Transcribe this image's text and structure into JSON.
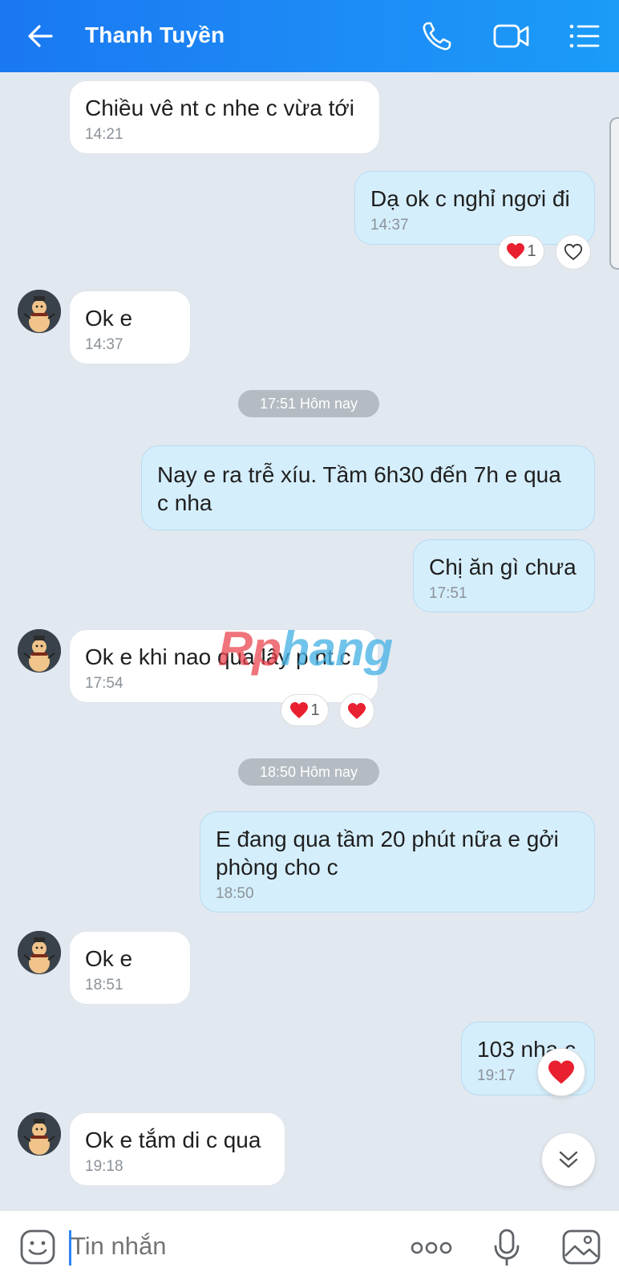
{
  "header": {
    "title": "Thanh Tuyền",
    "icons": [
      "back-arrow-icon",
      "phone-icon",
      "video-camera-icon",
      "menu-list-icon"
    ]
  },
  "messages": [
    {
      "direction": "in",
      "text": "Chiều vê nt c nhe c vừa tới",
      "time": "14:21"
    },
    {
      "direction": "out",
      "text": "Dạ ok c nghỉ ngơi đi",
      "time": "14:37",
      "reaction_count": "1"
    },
    {
      "direction": "in",
      "text": "Ok e",
      "time": "14:37"
    },
    {
      "direction": "out",
      "text": "Nay e ra trễ xíu. Tầm 6h30 đến 7h e qua\nc nha",
      "time": ""
    },
    {
      "direction": "out",
      "text": "Chị ăn gì chưa",
      "time": "17:51"
    },
    {
      "direction": "in",
      "text": "Ok e khi nao qua lây p nt c",
      "time": "17:54",
      "reaction_count": "1"
    },
    {
      "direction": "out",
      "text": "E đang qua tầm 20 phút nữa e gởi\nphòng cho c",
      "time": "18:50"
    },
    {
      "direction": "in",
      "text": "Ok e",
      "time": "18:51"
    },
    {
      "direction": "out",
      "text": "103 nha c",
      "time": "19:17"
    },
    {
      "direction": "in",
      "text": "Ok e tắm di c qua",
      "time": "19:18"
    }
  ],
  "dividers": [
    "17:51 Hôm nay",
    "18:50 Hôm nay"
  ],
  "watermark": {
    "part1": "Rp",
    "part2": "hang"
  },
  "composer": {
    "placeholder": "Tin nhắn"
  },
  "colors": {
    "header": "#1d8df5",
    "outgoing_bubble": "#d5eefc",
    "incoming_bubble": "#ffffff",
    "background": "#e2e8ef",
    "heart": "#e8202f"
  }
}
